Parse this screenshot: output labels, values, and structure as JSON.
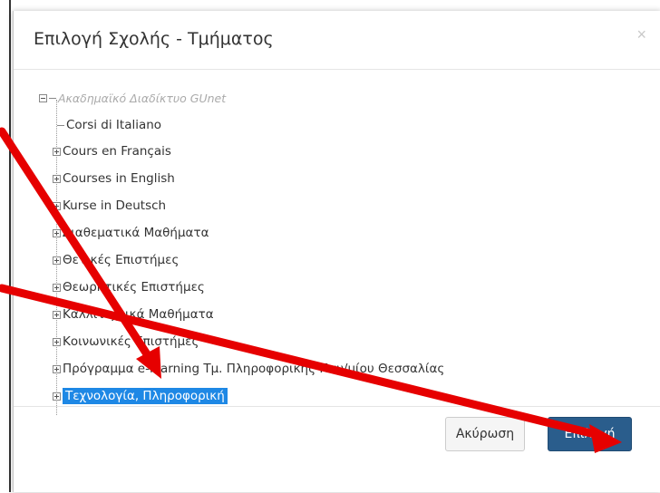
{
  "dialog": {
    "title": "Επιλογή Σχολής - Τμήματος",
    "close_symbol": "×",
    "cancel_label": "Ακύρωση",
    "ok_label": "Επιλογή"
  },
  "tree": {
    "root_label": "Ακαδημαϊκό Διαδίκτυο GUnet",
    "items": [
      {
        "label": "Corsi di Italiano"
      },
      {
        "label": "Cours en Français"
      },
      {
        "label": "Courses in English"
      },
      {
        "label": "Kurse in Deutsch"
      },
      {
        "label": "Διαθεματικά Μαθήματα"
      },
      {
        "label": "Θετικές Επιστήμες"
      },
      {
        "label": "Θεωρητικές Επιστήμες"
      },
      {
        "label": "Καλλιτεχνικά Μαθήματα"
      },
      {
        "label": "Κοινωνικές Επιστήμες"
      },
      {
        "label": "Πρόγραμμα e-learning Τμ. Πληροφορικής Παν/μίου Θεσσαλίας"
      },
      {
        "label": "Τεχνολογία, Πληροφορική"
      }
    ]
  },
  "colors": {
    "arrow": "#e60000",
    "selected": "#1e88e5",
    "primary_button": "#2a5d8c"
  }
}
